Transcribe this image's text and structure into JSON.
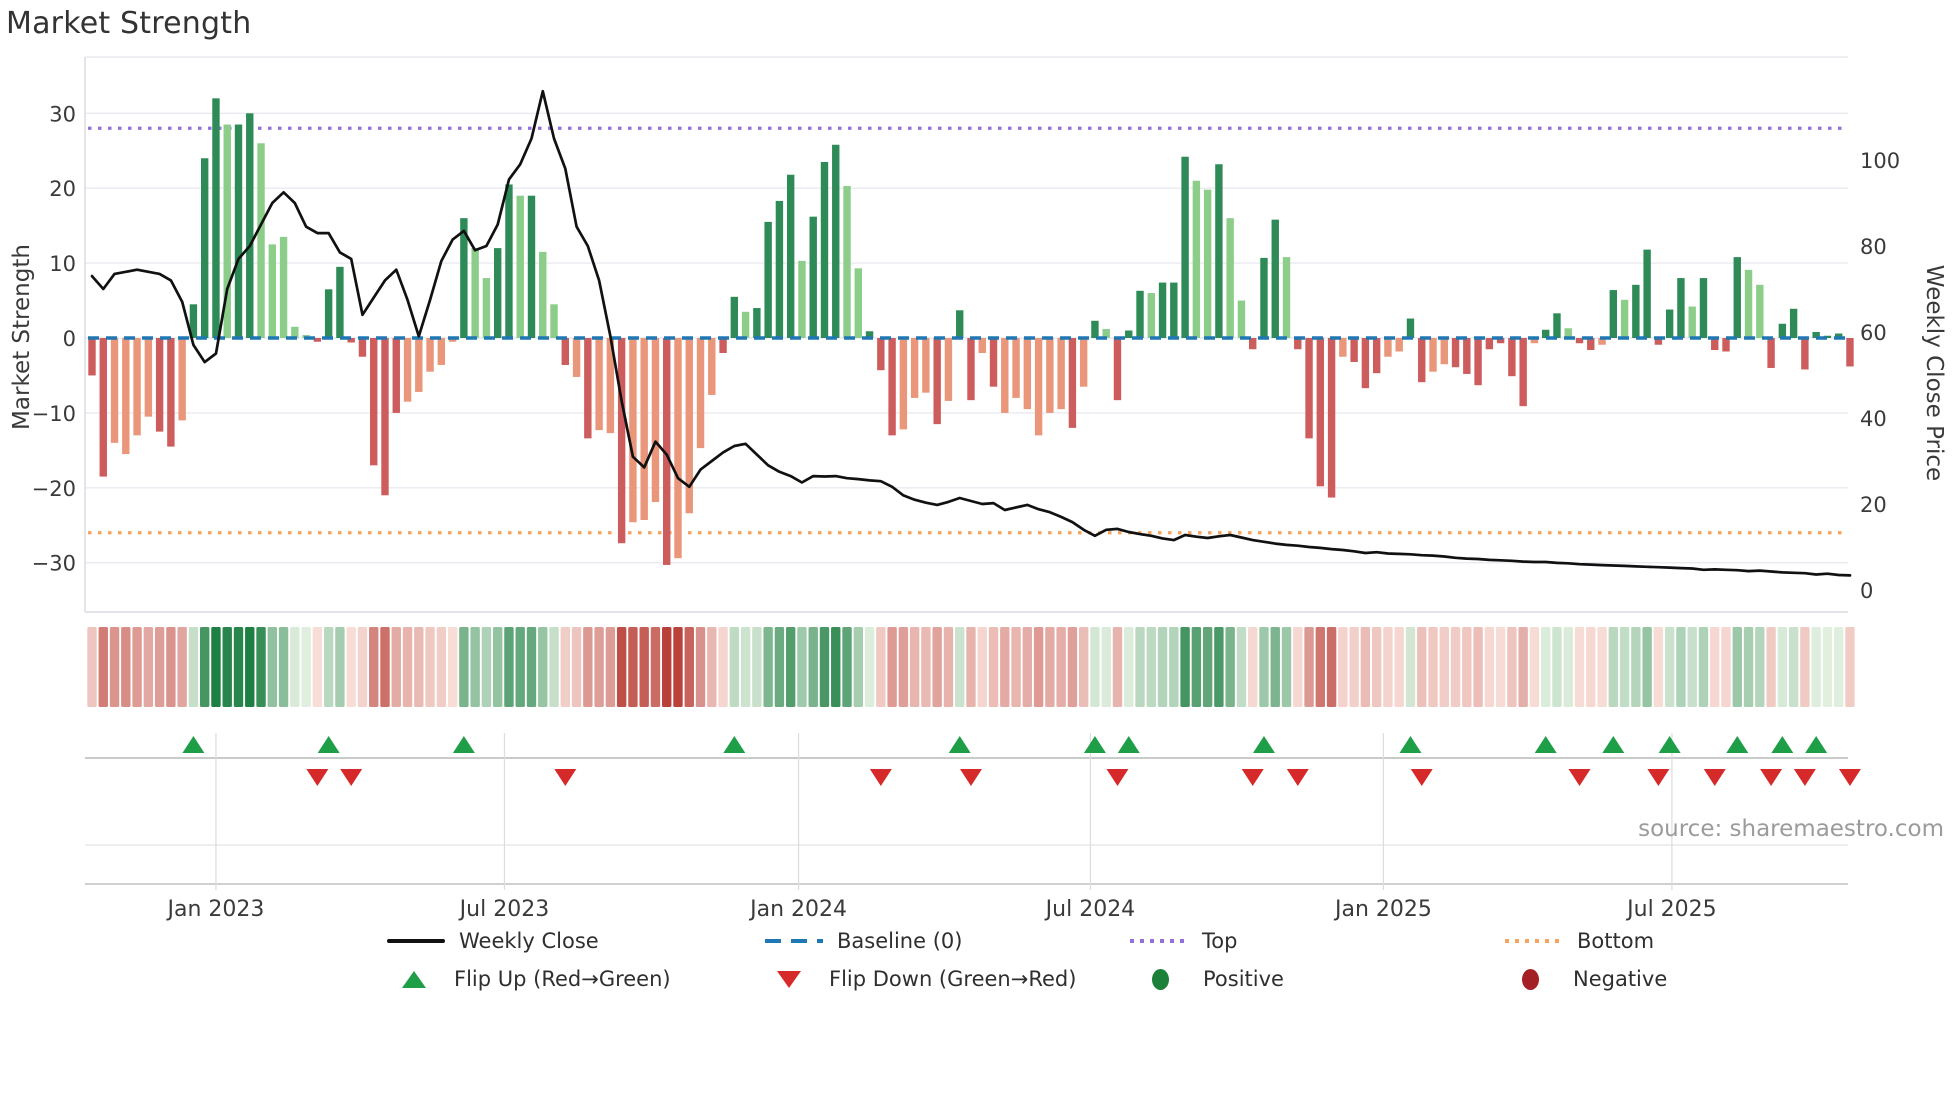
{
  "title": "Market Strength",
  "source": "source: sharemaestro.com",
  "axes": {
    "left_label": "Market Strength",
    "right_label": "Weekly Close Price",
    "left_ticks": [
      30,
      20,
      10,
      0,
      -10,
      -20,
      -30
    ],
    "right_ticks": [
      100,
      80,
      60,
      40,
      20,
      0
    ],
    "x_ticks": [
      {
        "label": "Jan 2023",
        "week": 11.0
      },
      {
        "label": "Jul 2023",
        "week": 36.6
      },
      {
        "label": "Jan 2024",
        "week": 62.7
      },
      {
        "label": "Jul 2024",
        "week": 88.6
      },
      {
        "label": "Jan 2025",
        "week": 114.6
      },
      {
        "label": "Jul 2025",
        "week": 140.2
      }
    ]
  },
  "chart_data": {
    "type": "combo",
    "title": "Market Strength",
    "frequency": "weekly",
    "start_date": "2022-10-17",
    "baseline": 0,
    "top_threshold": 28,
    "bottom_threshold": -26,
    "left_ylim": [
      -36.5,
      37.5
    ],
    "right_ylim": [
      -5,
      124
    ],
    "grid": "horizontal",
    "series": [
      {
        "name": "Market Strength",
        "type": "bar",
        "axis": "left",
        "values": [
          -5.0,
          -18.5,
          -14.0,
          -15.5,
          -13.0,
          -10.5,
          -12.5,
          -14.5,
          -11.0,
          4.5,
          24.0,
          32.0,
          28.5,
          28.5,
          30.0,
          26.0,
          12.5,
          13.5,
          1.5,
          0.4,
          -0.5,
          6.5,
          9.5,
          -0.6,
          -2.5,
          -17.0,
          -21.0,
          -10.0,
          -8.5,
          -7.2,
          -4.5,
          -3.6,
          -0.5,
          16.0,
          12.0,
          8.0,
          12.0,
          20.5,
          19.0,
          19.0,
          11.5,
          4.5,
          -3.6,
          -5.2,
          -13.4,
          -12.3,
          -12.7,
          -27.4,
          -24.6,
          -24.3,
          -21.9,
          -30.3,
          -29.4,
          -23.4,
          -14.7,
          -7.6,
          -2.0,
          5.5,
          3.5,
          4.0,
          15.5,
          18.3,
          21.8,
          10.3,
          16.2,
          23.5,
          25.8,
          20.3,
          9.3,
          0.9,
          -4.3,
          -13.0,
          -12.2,
          -8.0,
          -7.3,
          -11.5,
          -8.4,
          3.7,
          -8.3,
          -2.0,
          -6.5,
          -10.0,
          -8.0,
          -9.5,
          -13.0,
          -10.0,
          -9.5,
          -12.0,
          -6.5,
          2.3,
          1.2,
          -8.3,
          1.0,
          6.3,
          6.0,
          7.4,
          7.4,
          24.2,
          21.0,
          19.8,
          23.2,
          16.0,
          5.0,
          -1.5,
          10.7,
          15.8,
          10.8,
          -1.5,
          -13.4,
          -19.8,
          -21.3,
          -2.5,
          -3.2,
          -6.7,
          -4.7,
          -2.5,
          -1.8,
          2.6,
          -5.9,
          -4.5,
          -3.5,
          -3.9,
          -4.8,
          -6.3,
          -1.5,
          -0.7,
          -5.1,
          -9.1,
          -0.7,
          1.1,
          3.3,
          1.3,
          -0.7,
          -1.6,
          -0.9,
          6.4,
          5.1,
          7.1,
          11.8,
          -0.9,
          3.8,
          8.0,
          4.2,
          8.0,
          -1.6,
          -1.8,
          10.8,
          9.1,
          7.1,
          -4.0,
          1.9,
          3.9,
          -4.2,
          0.8,
          0.3,
          0.6,
          -3.8
        ]
      },
      {
        "name": "Bar Shade (1=light,0=dark)",
        "type": "style",
        "values": [
          0,
          0,
          1,
          1,
          1,
          1,
          0,
          0,
          1,
          0,
          0,
          0,
          1,
          0,
          0,
          1,
          1,
          1,
          1,
          1,
          0,
          0,
          0,
          0,
          0,
          0,
          0,
          0,
          1,
          1,
          1,
          1,
          1,
          0,
          1,
          1,
          0,
          0,
          1,
          0,
          1,
          1,
          0,
          1,
          0,
          1,
          1,
          0,
          1,
          1,
          1,
          0,
          1,
          1,
          1,
          1,
          0,
          0,
          1,
          0,
          0,
          0,
          0,
          1,
          0,
          0,
          0,
          1,
          1,
          0,
          0,
          0,
          1,
          1,
          1,
          0,
          1,
          0,
          0,
          1,
          0,
          1,
          1,
          1,
          1,
          1,
          1,
          0,
          1,
          0,
          1,
          0,
          0,
          0,
          1,
          0,
          0,
          0,
          1,
          1,
          0,
          1,
          1,
          0,
          0,
          0,
          1,
          0,
          0,
          0,
          0,
          1,
          0,
          0,
          0,
          1,
          1,
          0,
          0,
          1,
          1,
          0,
          0,
          0,
          0,
          0,
          0,
          0,
          1,
          0,
          0,
          1,
          0,
          0,
          1,
          0,
          1,
          0,
          0,
          0,
          0,
          0,
          1,
          0,
          0,
          0,
          0,
          1,
          1,
          0,
          0,
          0,
          0,
          0,
          0,
          0,
          0
        ]
      },
      {
        "name": "Weekly Close",
        "type": "line",
        "axis": "right",
        "values": [
          73,
          70,
          73.5,
          74,
          74.5,
          74,
          73.5,
          72,
          67,
          57,
          53,
          55,
          70,
          77,
          80,
          85,
          90,
          92.5,
          90,
          84.5,
          83,
          83,
          78.5,
          77,
          64,
          68,
          72,
          74.5,
          67.5,
          59,
          67.5,
          76.5,
          81.5,
          83.5,
          79,
          80,
          85,
          95.5,
          99,
          105,
          116,
          105,
          98,
          84.5,
          80,
          72,
          59,
          44,
          31,
          28.5,
          34.5,
          31.5,
          26,
          24,
          28,
          30,
          32,
          33.5,
          34,
          31.5,
          29,
          27.5,
          26.5,
          25,
          26.5,
          26.4,
          26.5,
          26,
          25.8,
          25.5,
          25.3,
          24,
          22,
          21,
          20.3,
          19.8,
          20.5,
          21.4,
          20.7,
          20,
          20.2,
          18.6,
          19.2,
          19.8,
          18.8,
          18.1,
          17,
          15.8,
          14,
          12.6,
          14,
          14.2,
          13.5,
          13,
          12.6,
          12,
          11.6,
          12.8,
          12.4,
          12.1,
          12.5,
          12.8,
          12.2,
          11.6,
          11.2,
          10.8,
          10.5,
          10.3,
          10,
          9.8,
          9.5,
          9.3,
          9,
          8.6,
          8.8,
          8.5,
          8.4,
          8.3,
          8.1,
          8,
          7.8,
          7.5,
          7.3,
          7.2,
          7,
          6.9,
          6.8,
          6.6,
          6.5,
          6.5,
          6.3,
          6.2,
          6,
          5.9,
          5.8,
          5.7,
          5.6,
          5.5,
          5.4,
          5.3,
          5.2,
          5.1,
          5,
          4.7,
          4.8,
          4.7,
          4.6,
          4.4,
          4.5,
          4.3,
          4.1,
          4,
          3.9,
          3.6,
          3.8,
          3.5,
          3.4
        ]
      }
    ],
    "flip_up_weeks": [
      9,
      21,
      33,
      57,
      77,
      89,
      92,
      104,
      117,
      129,
      135,
      140,
      146,
      150,
      153
    ],
    "flip_down_weeks": [
      20,
      23,
      42,
      70,
      78,
      91,
      103,
      107,
      118,
      132,
      139,
      144,
      149,
      152,
      156
    ],
    "heatmap_note": "strip below chart encodes Market Strength value per week on a red-to-green scale, intensity proportional to |value|/30"
  },
  "legend": {
    "rows": [
      [
        {
          "name": "weekly-close",
          "label": "Weekly Close",
          "swatch": "sw-line"
        },
        {
          "name": "baseline",
          "label": "Baseline (0)",
          "swatch": "sw-dash"
        },
        {
          "name": "top",
          "label": "Top",
          "swatch": "sw-dot-p"
        },
        {
          "name": "bottom",
          "label": "Bottom",
          "swatch": "sw-dot-o"
        }
      ],
      [
        {
          "name": "flip-up",
          "label": "Flip Up (Red→Green)",
          "swatch": "sw-tri-up"
        },
        {
          "name": "flip-down",
          "label": "Flip Down (Green→Red)",
          "swatch": "sw-tri-dn"
        },
        {
          "name": "positive",
          "label": "Positive",
          "swatch": "sw-circ-g"
        },
        {
          "name": "negative",
          "label": "Negative",
          "swatch": "sw-circ-r"
        }
      ]
    ]
  },
  "colors": {
    "positive_dark": "#2e8b57",
    "positive_light": "#8ccd8a",
    "negative_dark": "#cd5c5c",
    "negative_light": "#e9967a",
    "weekly_close": "#111111",
    "baseline": "#1f77b4",
    "top": "#9370db",
    "bottom": "#f4a460",
    "flip_up": "#1f9e48",
    "flip_down": "#d62a2a",
    "positive_marker": "#1d8038",
    "negative_marker": "#a32026",
    "grid": "#eaeaf1",
    "heat_green_dark": "#1e7f43",
    "heat_green_light": "#e3f0e1",
    "heat_red_dark": "#b84038",
    "heat_red_light": "#f9e0da",
    "text": "#3a3a3a",
    "muted_text": "#9b9b9b"
  }
}
